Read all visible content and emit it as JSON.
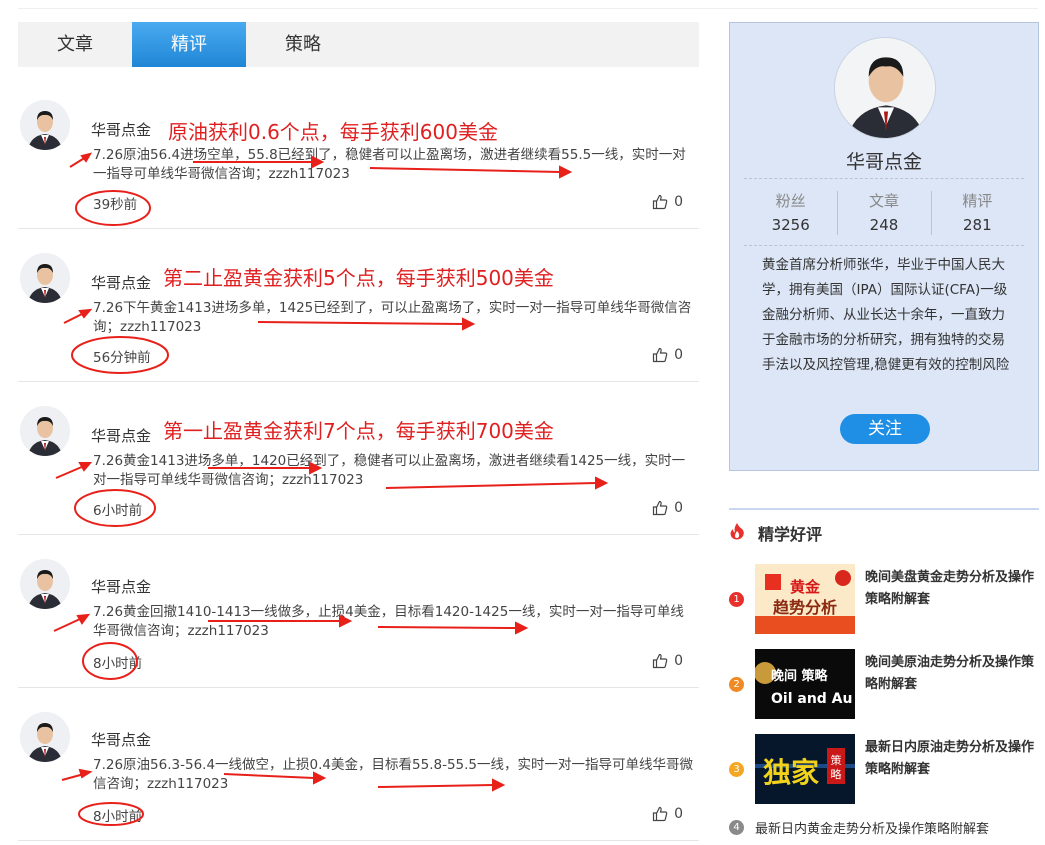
{
  "tabs": [
    {
      "label": "文章",
      "active": false
    },
    {
      "label": "精评",
      "active": true
    },
    {
      "label": "策略",
      "active": false
    }
  ],
  "posts": [
    {
      "author": "华哥点金",
      "headline": "原油获利0.6个点，每手获利600美金",
      "text": "7.26原油56.4进场空单，55.8已经到了，稳健者可以止盈离场，激进者继续看55.5一线，实时一对一指导可单线华哥微信咨询；zzzh117023",
      "time": "39秒前",
      "likes": "0"
    },
    {
      "author": "华哥点金",
      "headline": "第二止盈黄金获利5个点，每手获利500美金",
      "text": "7.26下午黄金1413进场多单，1425已经到了，可以止盈离场了，实时一对一指导可单线华哥微信咨询；zzzh117023",
      "time": "56分钟前",
      "likes": "0"
    },
    {
      "author": "华哥点金",
      "headline": "第一止盈黄金获利7个点，每手获利700美金",
      "text": "7.26黄金1413进场多单，1420已经到了，稳健者可以止盈离场，激进者继续看1425一线，实时一对一指导可单线华哥微信咨询；zzzh117023",
      "time": "6小时前",
      "likes": "0"
    },
    {
      "author": "华哥点金",
      "headline": "",
      "text": "7.26黄金回撤1410-1413一线做多，止损4美金，目标看1420-1425一线，实时一对一指导可单线华哥微信咨询；zzzh117023",
      "time": "8小时前",
      "likes": "0"
    },
    {
      "author": "华哥点金",
      "headline": "",
      "text": "7.26原油56.3-56.4一线做空，止损0.4美金，目标看55.8-55.5一线，实时一对一指导可单线华哥微信咨询；zzzh117023",
      "time": "8小时前",
      "likes": "0"
    }
  ],
  "profile": {
    "name": "华哥点金",
    "stats": [
      {
        "label": "粉丝",
        "value": "3256"
      },
      {
        "label": "文章",
        "value": "248"
      },
      {
        "label": "精评",
        "value": "281"
      }
    ],
    "bio": "黄金首席分析师张华，毕业于中国人民大学，拥有美国（IPA）国际认证(CFA)一级金融分析师、从业长达十余年，一直致力于金融市场的分析研究，拥有独特的交易手法以及风控管理,稳健更有效的控制风险",
    "follow_label": "关注"
  },
  "recommended": {
    "title": "精学好评",
    "items": [
      {
        "rank": "1",
        "title": "晚间美盘黄金走势分析及操作策略附解套",
        "thumb_text": "黄金 趋势分析",
        "rank_color": "#e8302c"
      },
      {
        "rank": "2",
        "title": "晚间美原油走势分析及操作策略附解套",
        "thumb_text": "晚间 策略 Oil and Au",
        "rank_color": "#f08a24"
      },
      {
        "rank": "3",
        "title": "最新日内原油走势分析及操作策略附解套",
        "thumb_text": "独家 策略",
        "rank_color": "#f5a623"
      },
      {
        "rank": "4",
        "title": "最新日内黄金走势分析及操作策略附解套",
        "rank_color": "#8a8a8a"
      }
    ]
  },
  "colors": {
    "accent": "#1f8fe6",
    "headline": "#e02020",
    "annotation": "#e8201a"
  }
}
